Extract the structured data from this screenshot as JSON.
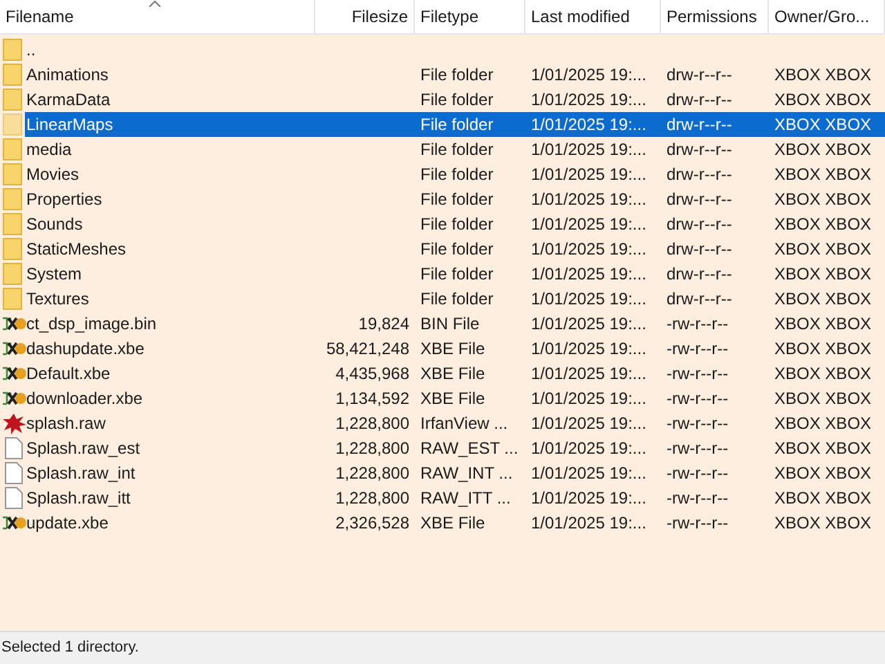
{
  "columns": [
    {
      "label": "Filename",
      "sorted": true
    },
    {
      "label": "Filesize",
      "sorted": false
    },
    {
      "label": "Filetype",
      "sorted": false
    },
    {
      "label": "Last modified",
      "sorted": false
    },
    {
      "label": "Permissions",
      "sorted": false
    },
    {
      "label": "Owner/Gro...",
      "sorted": false
    }
  ],
  "rows": [
    {
      "kind": "folder",
      "name": "..",
      "selected": false
    },
    {
      "kind": "folder",
      "name": "Animations",
      "type": "File folder",
      "modified": "1/01/2025 19:...",
      "permissions": "drw-r--r--",
      "owner": "XBOX XBOX",
      "selected": false
    },
    {
      "kind": "folder",
      "name": "KarmaData",
      "type": "File folder",
      "modified": "1/01/2025 19:...",
      "permissions": "drw-r--r--",
      "owner": "XBOX XBOX",
      "selected": false
    },
    {
      "kind": "folder",
      "name": "LinearMaps",
      "type": "File folder",
      "modified": "1/01/2025 19:...",
      "permissions": "drw-r--r--",
      "owner": "XBOX XBOX",
      "selected": true
    },
    {
      "kind": "folder",
      "name": "media",
      "type": "File folder",
      "modified": "1/01/2025 19:...",
      "permissions": "drw-r--r--",
      "owner": "XBOX XBOX",
      "selected": false
    },
    {
      "kind": "folder",
      "name": "Movies",
      "type": "File folder",
      "modified": "1/01/2025 19:...",
      "permissions": "drw-r--r--",
      "owner": "XBOX XBOX",
      "selected": false
    },
    {
      "kind": "folder",
      "name": "Properties",
      "type": "File folder",
      "modified": "1/01/2025 19:...",
      "permissions": "drw-r--r--",
      "owner": "XBOX XBOX",
      "selected": false
    },
    {
      "kind": "folder",
      "name": "Sounds",
      "type": "File folder",
      "modified": "1/01/2025 19:...",
      "permissions": "drw-r--r--",
      "owner": "XBOX XBOX",
      "selected": false
    },
    {
      "kind": "folder",
      "name": "StaticMeshes",
      "type": "File folder",
      "modified": "1/01/2025 19:...",
      "permissions": "drw-r--r--",
      "owner": "XBOX XBOX",
      "selected": false
    },
    {
      "kind": "folder",
      "name": "System",
      "type": "File folder",
      "modified": "1/01/2025 19:...",
      "permissions": "drw-r--r--",
      "owner": "XBOX XBOX",
      "selected": false
    },
    {
      "kind": "folder",
      "name": "Textures",
      "type": "File folder",
      "modified": "1/01/2025 19:...",
      "permissions": "drw-r--r--",
      "owner": "XBOX XBOX",
      "selected": false
    },
    {
      "kind": "executable",
      "name": "ct_dsp_image.bin",
      "size": "19,824",
      "type": "BIN File",
      "modified": "1/01/2025 19:...",
      "permissions": "-rw-r--r--",
      "owner": "XBOX XBOX",
      "selected": false
    },
    {
      "kind": "executable",
      "name": "dashupdate.xbe",
      "size": "58,421,248",
      "type": "XBE File",
      "modified": "1/01/2025 19:...",
      "permissions": "-rw-r--r--",
      "owner": "XBOX XBOX",
      "selected": false
    },
    {
      "kind": "executable",
      "name": "Default.xbe",
      "size": "4,435,968",
      "type": "XBE File",
      "modified": "1/01/2025 19:...",
      "permissions": "-rw-r--r--",
      "owner": "XBOX XBOX",
      "selected": false
    },
    {
      "kind": "executable",
      "name": "downloader.xbe",
      "size": "1,134,592",
      "type": "XBE File",
      "modified": "1/01/2025 19:...",
      "permissions": "-rw-r--r--",
      "owner": "XBOX XBOX",
      "selected": false
    },
    {
      "kind": "image",
      "name": "splash.raw",
      "size": "1,228,800",
      "type": "IrfanView ...",
      "modified": "1/01/2025 19:...",
      "permissions": "-rw-r--r--",
      "owner": "XBOX XBOX",
      "selected": false
    },
    {
      "kind": "file",
      "name": "Splash.raw_est",
      "size": "1,228,800",
      "type": "RAW_EST ...",
      "modified": "1/01/2025 19:...",
      "permissions": "-rw-r--r--",
      "owner": "XBOX XBOX",
      "selected": false
    },
    {
      "kind": "file",
      "name": "Splash.raw_int",
      "size": "1,228,800",
      "type": "RAW_INT ...",
      "modified": "1/01/2025 19:...",
      "permissions": "-rw-r--r--",
      "owner": "XBOX XBOX",
      "selected": false
    },
    {
      "kind": "file",
      "name": "Splash.raw_itt",
      "size": "1,228,800",
      "type": "RAW_ITT ...",
      "modified": "1/01/2025 19:...",
      "permissions": "-rw-r--r--",
      "owner": "XBOX XBOX",
      "selected": false
    },
    {
      "kind": "executable",
      "name": "update.xbe",
      "size": "2,326,528",
      "type": "XBE File",
      "modified": "1/01/2025 19:...",
      "permissions": "-rw-r--r--",
      "owner": "XBOX XBOX",
      "selected": false
    }
  ],
  "status_bar": "Selected 1 directory."
}
